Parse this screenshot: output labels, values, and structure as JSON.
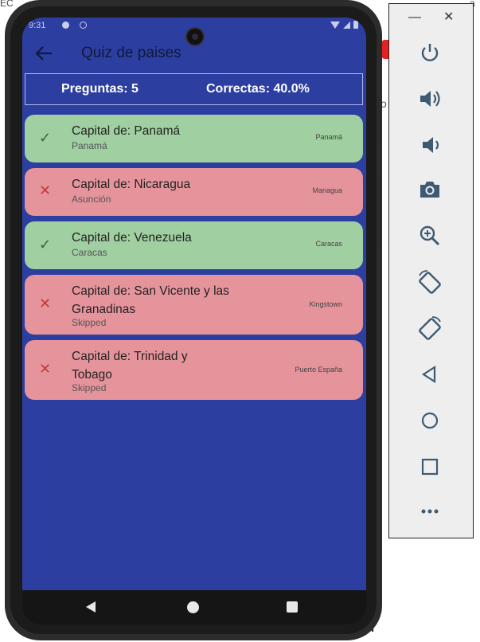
{
  "background": {
    "top_fragments": [
      "EC",
      "oc",
      "a"
    ],
    "bottom_text": "al"
  },
  "status_bar": {
    "time": "9:31"
  },
  "app_bar": {
    "title": "Quiz de paises"
  },
  "summary": {
    "questions_label": "Preguntas: 5",
    "correct_label": "Correctas: 40.0%"
  },
  "results": [
    {
      "question": "Capital de: Panamá",
      "user_answer": "Panamá",
      "correct_answer": "Panamá",
      "is_correct": true
    },
    {
      "question": "Capital de: Nicaragua",
      "user_answer": "Asunción",
      "correct_answer": "Managua",
      "is_correct": false
    },
    {
      "question": "Capital de: Venezuela",
      "user_answer": "Caracas",
      "correct_answer": "Caracas",
      "is_correct": true
    },
    {
      "question": "Capital de: San Vicente y las Granadinas",
      "user_answer": "Skipped",
      "correct_answer": "Kingstown",
      "is_correct": false
    },
    {
      "question": "Capital de: Trinidad y Tobago",
      "user_answer": "Skipped",
      "correct_answer": "Puerto España",
      "is_correct": false
    }
  ],
  "icons": {
    "correct": "check-icon",
    "wrong": "close-icon",
    "back": "arrow-left-icon"
  },
  "colors": {
    "screen_bg": "#2d3ea1",
    "correct_card": "#a0cfa1",
    "wrong_card": "#e6949c"
  },
  "emulator_toolbar": {
    "buttons": [
      "power-icon",
      "volume-up-icon",
      "volume-down-icon",
      "camera-icon",
      "zoom-in-icon",
      "rotate-left-icon",
      "rotate-right-icon",
      "back-icon",
      "home-icon",
      "overview-icon",
      "more-icon"
    ]
  }
}
